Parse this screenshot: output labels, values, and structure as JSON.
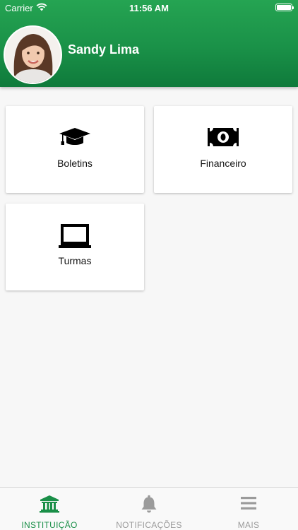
{
  "status_bar": {
    "carrier": "Carrier",
    "time": "11:56 AM"
  },
  "profile": {
    "name": "Sandy Lima",
    "avatar_icon": "user-photo"
  },
  "menu": [
    {
      "label": "Boletins",
      "icon": "graduation-cap-icon"
    },
    {
      "label": "Financeiro",
      "icon": "money-bill-icon"
    },
    {
      "label": "Turmas",
      "icon": "chalkboard-icon"
    }
  ],
  "tabs": [
    {
      "label": "INSTITUIÇÃO",
      "icon": "institution-icon",
      "active": true
    },
    {
      "label": "NOTIFICAÇÕES",
      "icon": "bell-icon",
      "active": false
    },
    {
      "label": "MAIS",
      "icon": "menu-icon",
      "active": false
    }
  ],
  "colors": {
    "brand": "#1a9148",
    "active_tab": "#1a8f48",
    "inactive_tab": "#9b9b9b"
  }
}
